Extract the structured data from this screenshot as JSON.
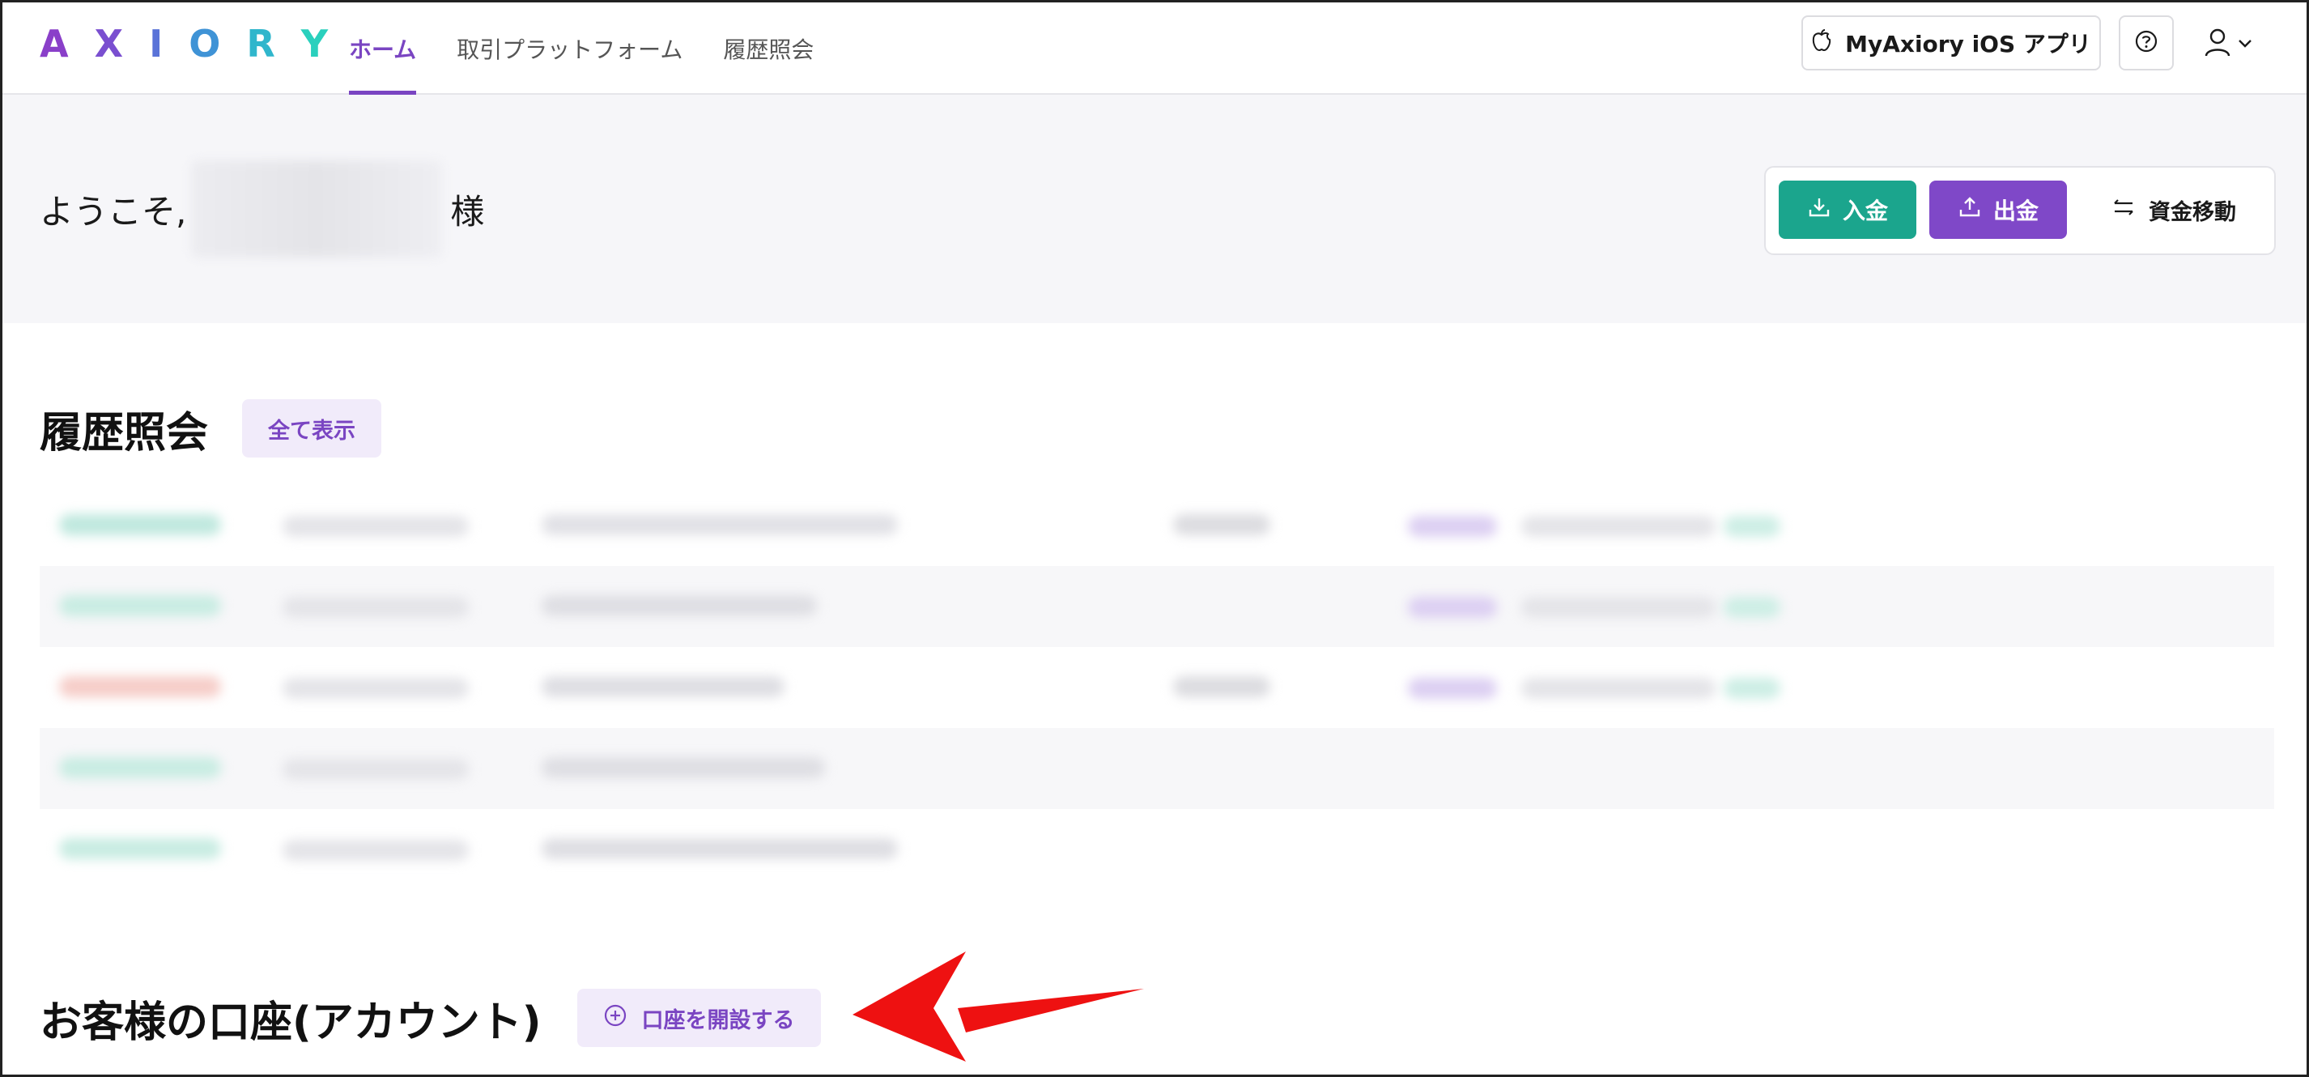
{
  "brand": {
    "logo_letters": [
      "A",
      "X",
      "I",
      "O",
      "R",
      "Y"
    ],
    "logo_colors": [
      "#8a3fc9",
      "#7a4fd0",
      "#5a73d8",
      "#3f93d6",
      "#30b6cc",
      "#2ad0bd"
    ]
  },
  "nav": {
    "items": [
      {
        "label": "ホーム",
        "active": true
      },
      {
        "label": "取引プラットフォーム",
        "active": false
      },
      {
        "label": "履歴照会",
        "active": false
      }
    ],
    "ios_app_label": "MyAxiory iOS アプリ"
  },
  "welcome": {
    "greeting_prefix": "ようこそ,",
    "greeting_suffix": "様"
  },
  "actions": {
    "deposit_label": "入金",
    "withdraw_label": "出金",
    "transfer_label": "資金移動"
  },
  "history": {
    "title": "履歴照会",
    "show_all_label": "全て表示"
  },
  "accounts": {
    "title": "お客様の口座(アカウント)",
    "open_account_label": "口座を開設する"
  },
  "colors": {
    "accent": "#7a45c2",
    "deposit": "#1ba58d",
    "withdraw": "#7f48c8",
    "annotation_arrow": "#ee1111"
  }
}
